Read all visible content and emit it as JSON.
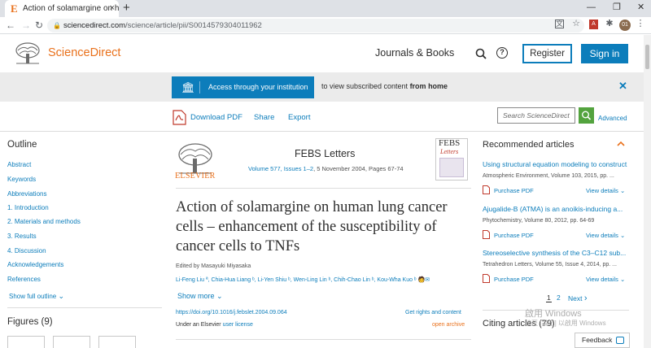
{
  "browser": {
    "tab_title": "Action of solamargine on hum",
    "favicon_letter": "E",
    "new_tab": "+",
    "tab_close": "×",
    "url_domain": "sciencedirect.com",
    "url_path": "/science/article/pii/S0014579304011962",
    "profile_initials": "01",
    "window_controls": {
      "minimize": "—",
      "restore": "❐",
      "close": "✕"
    },
    "icons": [
      "back-icon",
      "forward-icon",
      "reload-icon",
      "lock-icon",
      "translate-icon",
      "star-icon",
      "pdf-extension-icon",
      "extensions-icon",
      "menu-icon"
    ]
  },
  "site": {
    "brand": "ScienceDirect",
    "journals_books": "Journals & Books",
    "register": "Register",
    "sign_in": "Sign in"
  },
  "banner": {
    "access_button": "Access through your institution",
    "text_prefix": "to view subscribed content ",
    "text_bold": "from home",
    "close": "✕"
  },
  "actions": {
    "download_pdf": "Download PDF",
    "share": "Share",
    "export": "Export",
    "search_placeholder": "Search ScienceDirect",
    "advanced": "Advanced"
  },
  "outline": {
    "title": "Outline",
    "items": [
      "Abstract",
      "Keywords",
      "Abbreviations",
      "1. Introduction",
      "2. Materials and methods",
      "3. Results",
      "4. Discussion",
      "Acknowledgements",
      "References"
    ],
    "show_full": "Show full outline",
    "figures_title": "Figures (9)"
  },
  "article": {
    "publisher_word": "ELSEVIER",
    "journal": "FEBS Letters",
    "volume_link": "Volume 577, Issues 1–2",
    "volume_rest": ", 5 November 2004, Pages 67-74",
    "cover_title": "FEBS",
    "cover_subtitle": "Letters",
    "title": "Action of solamargine on human lung cancer cells – enhancement of the susceptibility of cancer cells to TNFs",
    "edited_by": "Edited by Masayuki Miyasaka",
    "authors": "Li-Feng Liu ª, Chia-Hua Liang ᵇ, Li-Yen Shiu ᵇ, Wen-Ling Lin ᵇ, Chih-Chao Lin ᵇ, Kou-Wha Kuo ᵇ 🧑✉",
    "show_more": "Show more",
    "doi": "https://doi.org/10.1016/j.febslet.2004.09.064",
    "license_prefix": "Under an Elsevier ",
    "license_link": "user license",
    "rights": "Get rights and content",
    "open_archive": "open archive"
  },
  "recommended": {
    "title": "Recommended articles",
    "items": [
      {
        "title": "Using structural equation modeling to construct...",
        "source": "Atmospheric Environment, Volume 103, 2015, pp. ...",
        "purchase": "Purchase PDF",
        "view": "View details"
      },
      {
        "title": "Ajugalide-B (ATMA) is an anoikis-inducing a...",
        "source": "Phytochemistry, Volume 80, 2012, pp. 64-69",
        "purchase": "Purchase PDF",
        "view": "View details"
      },
      {
        "title": "Stereoselective synthesis of the C3–C12 sub...",
        "source": "Tetrahedron Letters, Volume 55, Issue 4, 2014, pp. ...",
        "purchase": "Purchase PDF",
        "view": "View details"
      }
    ],
    "page1": "1",
    "page2": "2",
    "next": "Next"
  },
  "citing": {
    "title": "Citing articles (79)"
  },
  "watermark": {
    "line1": "啟用 Windows",
    "line2": "移至 [設定] 以啟用 Windows"
  },
  "feedback": "Feedback",
  "colors": {
    "brand_orange": "#e9711c",
    "link_blue": "#0c7dbb",
    "search_green": "#53a33e"
  }
}
